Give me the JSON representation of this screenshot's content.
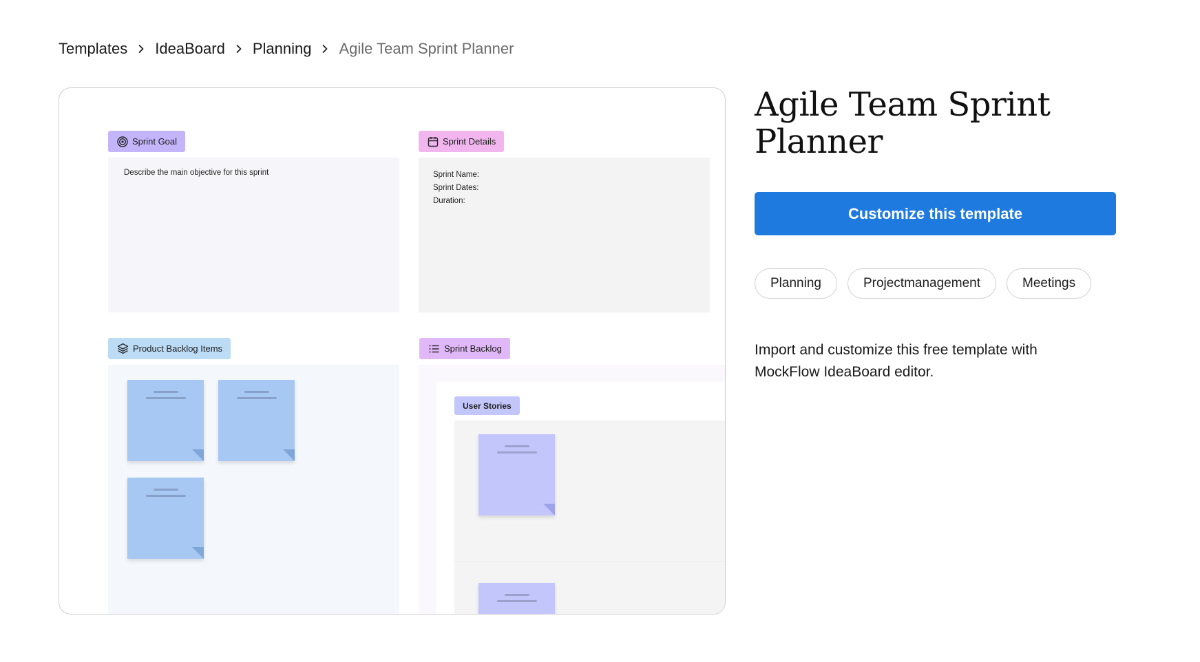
{
  "breadcrumb": {
    "items": [
      "Templates",
      "IdeaBoard",
      "Planning"
    ],
    "current": "Agile Team Sprint Planner"
  },
  "preview": {
    "sprint_goal": {
      "label": "Sprint Goal",
      "text": "Describe the main objective for this sprint",
      "tag_color": "#c4b5fa"
    },
    "sprint_details": {
      "label": "Sprint Details",
      "lines": [
        "Sprint Name:",
        "Sprint Dates:",
        "Duration:"
      ],
      "tag_color": "#f2b6ef"
    },
    "product_backlog": {
      "label": "Product Backlog Items",
      "tag_color": "#bcdcf6"
    },
    "sprint_backlog": {
      "label": "Sprint Backlog",
      "tag_color": "#e0b8f7",
      "user_stories_label": "User Stories"
    }
  },
  "title": "Agile Team Sprint Planner",
  "cta_label": "Customize this template",
  "tags": [
    "Planning",
    "Projectmanagement",
    "Meetings"
  ],
  "description": "Import and customize this free template with MockFlow IdeaBoard editor.",
  "colors": {
    "accent": "#1f7ae0",
    "note_blue": "#a7c8f3",
    "note_lavender": "#c3c6fb"
  }
}
